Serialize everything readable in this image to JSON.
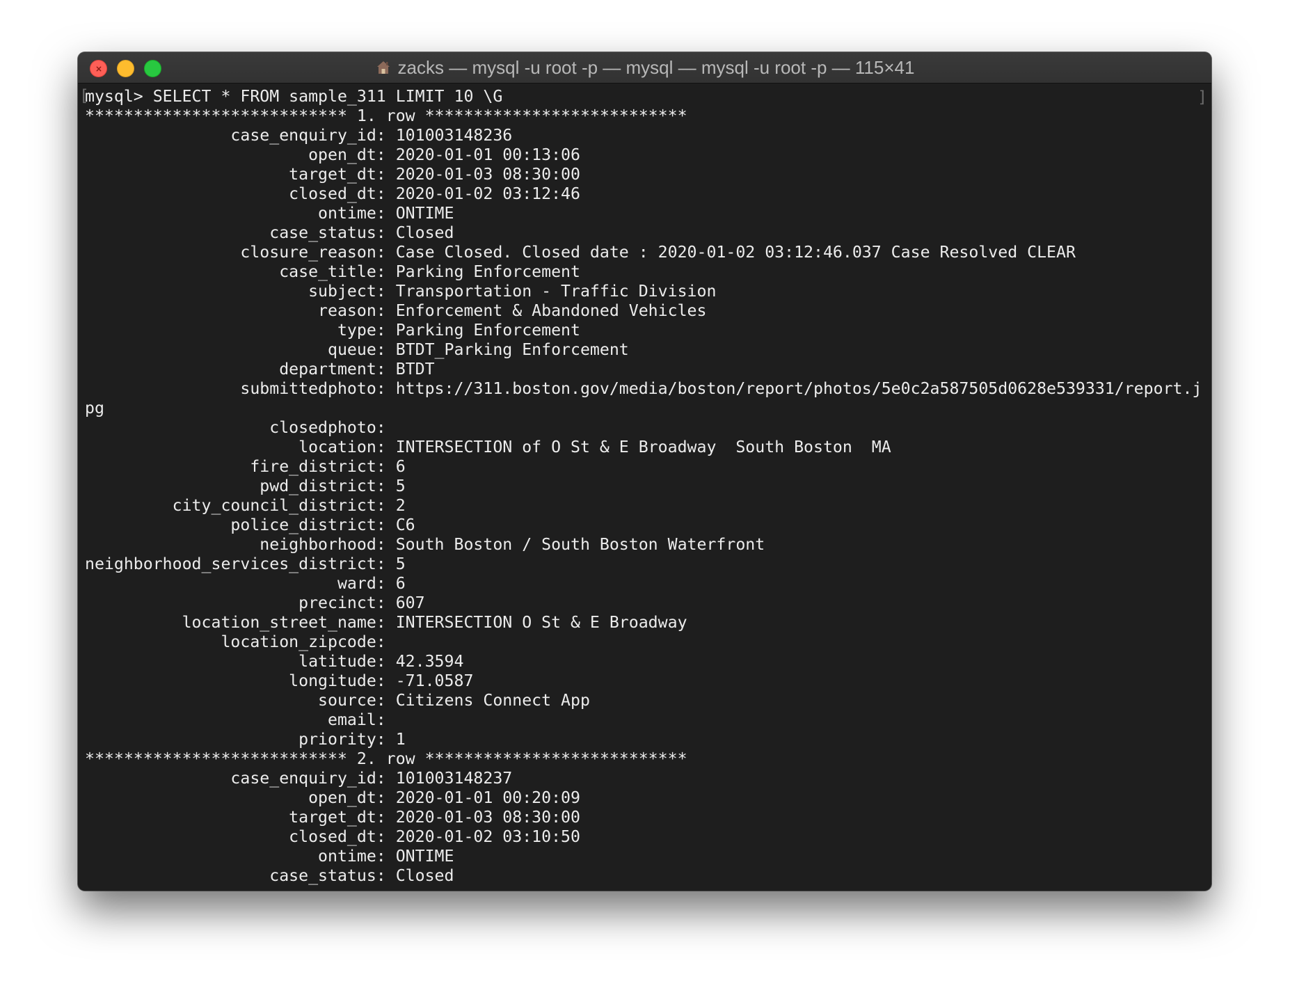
{
  "window": {
    "title": "zacks — mysql -u root -p — mysql — mysql -u root -p — 115×41",
    "icon": "house-icon"
  },
  "terminal": {
    "lines": [
      "mysql> SELECT * FROM sample_311 LIMIT 10 \\G",
      "*************************** 1. row ***************************",
      "               case_enquiry_id: 101003148236",
      "                       open_dt: 2020-01-01 00:13:06",
      "                     target_dt: 2020-01-03 08:30:00",
      "                     closed_dt: 2020-01-02 03:12:46",
      "                        ontime: ONTIME",
      "                   case_status: Closed",
      "                closure_reason: Case Closed. Closed date : 2020-01-02 03:12:46.037 Case Resolved CLEAR",
      "                    case_title: Parking Enforcement",
      "                       subject: Transportation - Traffic Division",
      "                        reason: Enforcement & Abandoned Vehicles",
      "                          type: Parking Enforcement",
      "                         queue: BTDT_Parking Enforcement",
      "                    department: BTDT",
      "                submittedphoto: https://311.boston.gov/media/boston/report/photos/5e0c2a587505d0628e539331/report.j",
      "pg",
      "                   closedphoto: ",
      "                      location: INTERSECTION of O St & E Broadway  South Boston  MA",
      "                 fire_district: 6",
      "                  pwd_district: 5",
      "         city_council_district: 2",
      "               police_district: C6",
      "                  neighborhood: South Boston / South Boston Waterfront",
      "neighborhood_services_district: 5",
      "                          ward: 6",
      "                      precinct: 607",
      "          location_street_name: INTERSECTION O St & E Broadway",
      "              location_zipcode: ",
      "                      latitude: 42.3594",
      "                     longitude: -71.0587",
      "                        source: Citizens Connect App",
      "                         email: ",
      "                      priority: 1",
      "*************************** 2. row ***************************",
      "               case_enquiry_id: 101003148237",
      "                       open_dt: 2020-01-01 00:20:09",
      "                     target_dt: 2020-01-03 08:30:00",
      "                     closed_dt: 2020-01-02 03:10:50",
      "                        ontime: ONTIME",
      "                   case_status: Closed"
    ]
  },
  "colors": {
    "background": "#1e1e1e",
    "text": "#ececec",
    "close": "#fe5f57",
    "minimize": "#febc2e",
    "maximize": "#28c840"
  }
}
